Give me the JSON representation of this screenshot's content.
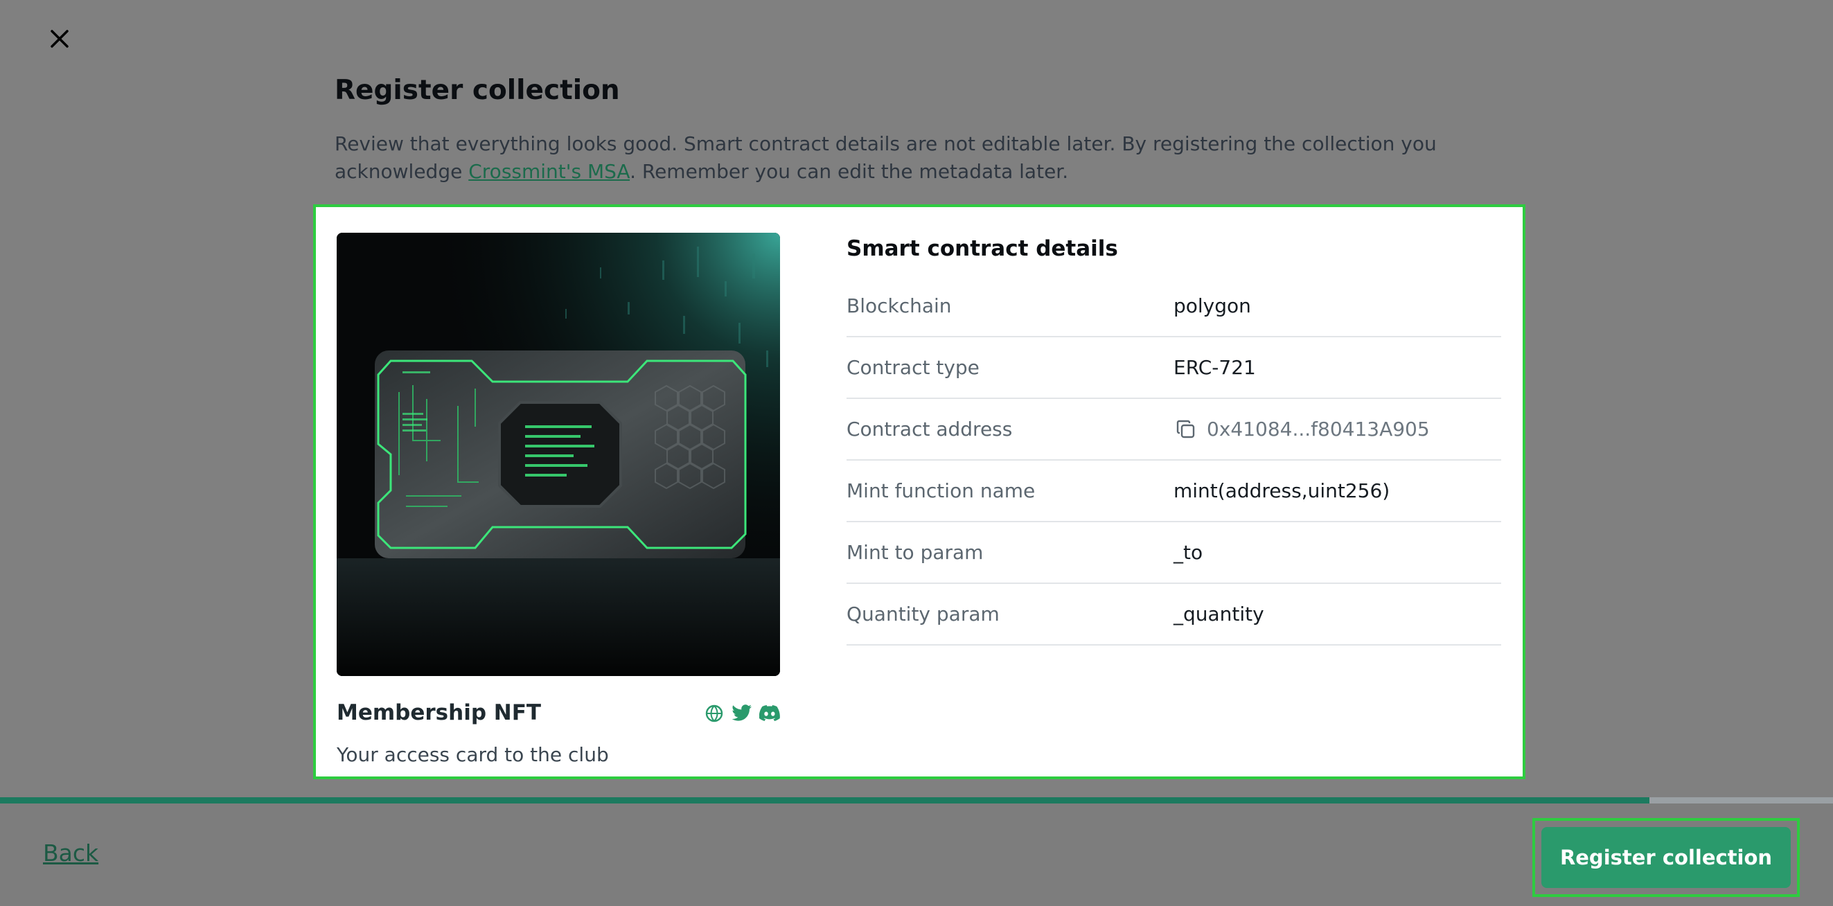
{
  "page": {
    "title": "Register collection",
    "intro_text": "Review that everything looks good. Smart contract details are not editable later. By registering the collection you acknowledge ",
    "intro_link": "Crossmint's MSA",
    "intro_suffix": ". Remember you can edit the metadata later."
  },
  "collection": {
    "name": "Membership NFT",
    "description": "Your access card to the club",
    "social_icons": [
      "globe-icon",
      "twitter-icon",
      "discord-icon"
    ]
  },
  "details": {
    "title": "Smart contract details",
    "rows": [
      {
        "label": "Blockchain",
        "value": "polygon"
      },
      {
        "label": "Contract type",
        "value": "ERC-721"
      },
      {
        "label": "Contract address",
        "value": "0x41084...f80413A905"
      },
      {
        "label": "Mint function name",
        "value": "mint(address,uint256)"
      },
      {
        "label": "Mint to param",
        "value": "_to"
      },
      {
        "label": "Quantity param",
        "value": "_quantity"
      }
    ]
  },
  "progress": {
    "fraction": 0.9
  },
  "footer": {
    "back_label": "Back",
    "register_label": "Register collection"
  },
  "colors": {
    "accent": "#2a9a6c",
    "highlight": "#2ecc40",
    "overlay": "#808080"
  }
}
